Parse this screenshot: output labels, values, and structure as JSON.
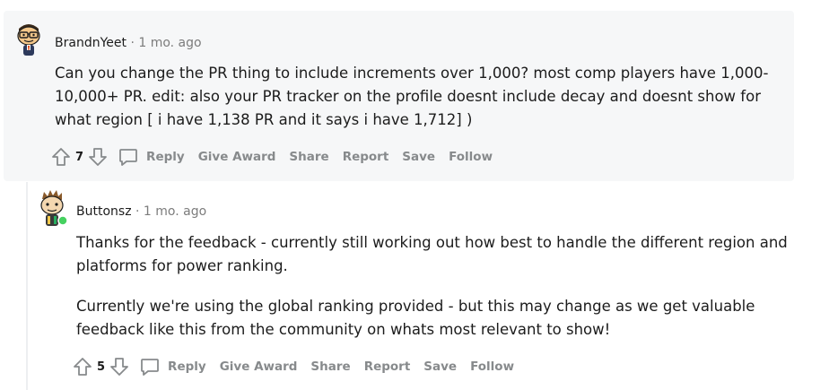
{
  "comments": [
    {
      "author": "BrandnYeet",
      "separator": "·",
      "time": "1 mo. ago",
      "body": [
        "Can you change the PR thing to include increments over 1,000? most comp players have 1,000-10,000+ PR. edit: also your PR tracker on the profile doesnt include decay and doesnt show for what region [ i have 1,138 PR and it says i have 1,712] )"
      ],
      "votes": "7",
      "actions": {
        "reply": "Reply",
        "award": "Give Award",
        "share": "Share",
        "report": "Report",
        "save": "Save",
        "follow": "Follow"
      }
    },
    {
      "author": "Buttonsz",
      "separator": "·",
      "time": "1 mo. ago",
      "body": [
        "Thanks for the feedback - currently still working out how best to handle the different region and platforms for power ranking.",
        "Currently we're using the global ranking provided - but this may change as we get valuable feedback like this from the community on whats most relevant to show!"
      ],
      "votes": "5",
      "online": true,
      "actions": {
        "reply": "Reply",
        "award": "Give Award",
        "share": "Share",
        "report": "Report",
        "save": "Save",
        "follow": "Follow"
      }
    }
  ],
  "colors": {
    "highlight_bg": "#f6f7f8",
    "action_text": "#878a8c",
    "online_dot": "#46d160"
  }
}
